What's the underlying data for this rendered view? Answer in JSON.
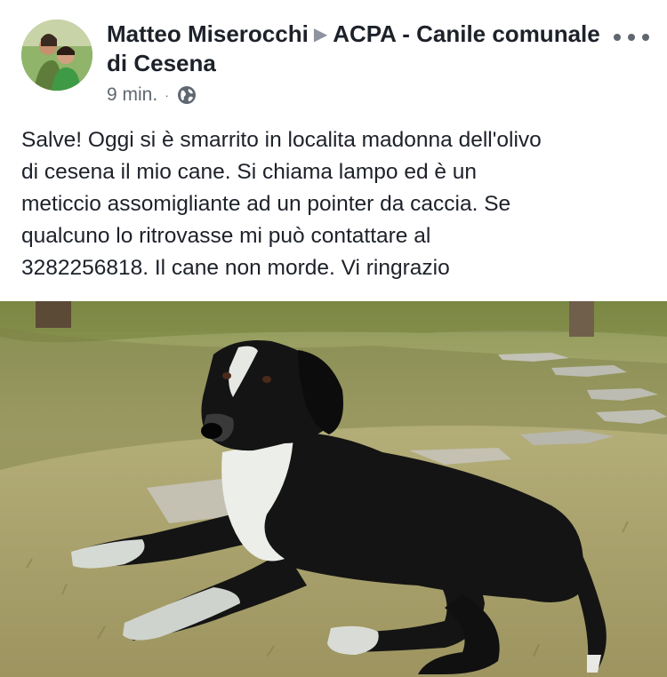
{
  "post": {
    "author": "Matteo Miserocchi",
    "target_page": "ACPA - Canile comunale di Cesena",
    "timestamp": "9 min.",
    "separator": "·",
    "privacy_icon": "globe-icon",
    "more_icon": "more-options-icon",
    "message": "Salve! Oggi si è smarrito in localita madonna dell'olivo\ndi cesena il mio cane. Si chiama lampo ed è un\nmeticcio assomigliante ad un pointer da caccia. Se\nqualcuno lo ritrovasse mi può contattare al\n3282256818. Il cane non morde. Vi ringrazio",
    "photo_subject": "black-and-white-dog-photo"
  },
  "colors": {
    "text": "#1d2129",
    "secondary_text": "#606770",
    "grass": "#a7a86b",
    "dog_black": "#141414",
    "dog_white": "#e9ece8"
  }
}
